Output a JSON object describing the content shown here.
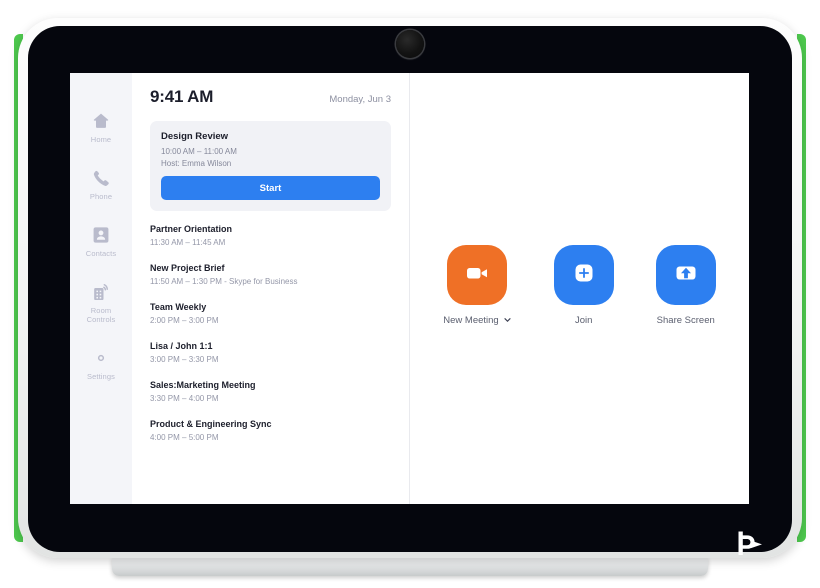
{
  "device": {
    "brand_logo_name": "poly-logo",
    "accent_color": "#4ec94e",
    "bezel_color": "#05060d",
    "frame_color": "#f2f3f2"
  },
  "sidebar": {
    "items": [
      {
        "label": "Home",
        "icon": "home-icon"
      },
      {
        "label": "Phone",
        "icon": "phone-icon"
      },
      {
        "label": "Contacts",
        "icon": "contacts-icon"
      },
      {
        "label": "Room\nControls",
        "icon": "room-controls-icon",
        "line1": "Room",
        "line2": "Controls"
      },
      {
        "label": "Settings",
        "icon": "gear-icon"
      }
    ]
  },
  "agenda": {
    "time": "9:41 AM",
    "date": "Monday, Jun 3",
    "featured_meeting": {
      "title": "Design Review",
      "time": "10:00 AM – 11:00 AM",
      "host": "Host: Emma Wilson",
      "start_label": "Start",
      "start_color": "#2d7ff0"
    },
    "upcoming": [
      {
        "title": "Partner Orientation",
        "time": "11:30 AM – 11:45 AM"
      },
      {
        "title": "New Project Brief",
        "time": "11:50 AM – 1:30 PM - Skype for Business"
      },
      {
        "title": "Team Weekly",
        "time": "2:00 PM – 3:00 PM"
      },
      {
        "title": "Lisa / John 1:1",
        "time": "3:00 PM – 3:30 PM"
      },
      {
        "title": "Sales:Marketing Meeting",
        "time": "3:30 PM – 4:00 PM"
      },
      {
        "title": "Product & Engineering Sync",
        "time": "4:00 PM – 5:00 PM"
      }
    ]
  },
  "actions": [
    {
      "label": "New Meeting",
      "icon": "video-camera-icon",
      "color": "#ef7026",
      "has_chevron": true
    },
    {
      "label": "Join",
      "icon": "plus-square-icon",
      "color": "#2d7ff0",
      "has_chevron": false
    },
    {
      "label": "Share Screen",
      "icon": "share-screen-arrow-icon",
      "color": "#2d7ff0",
      "has_chevron": false
    }
  ]
}
